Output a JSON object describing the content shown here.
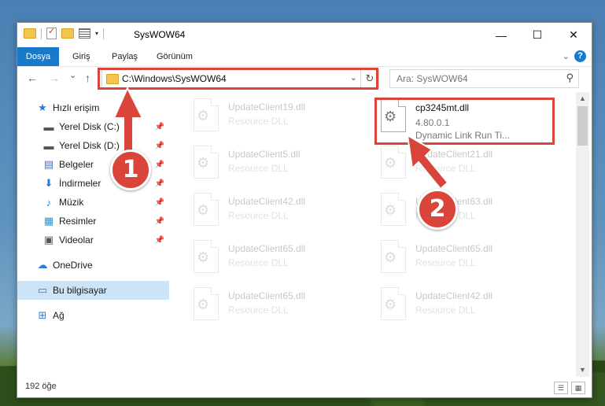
{
  "window": {
    "title": "SysWOW64",
    "controls": {
      "minimize": "—",
      "maximize": "☐",
      "close": "✕"
    }
  },
  "menu": {
    "file": "Dosya",
    "home": "Giriş",
    "share": "Paylaş",
    "view": "Görünüm",
    "help": "?"
  },
  "navigation": {
    "back": "←",
    "forward": "→",
    "recent": "⌄",
    "up": "↑",
    "address": "C:\\Windows\\SysWOW64",
    "refresh": "↻",
    "search_placeholder": "Ara: SysWOW64"
  },
  "sidebar": {
    "items": [
      {
        "label": "Hızlı erişim",
        "icon": "star-icon",
        "pinned": false
      },
      {
        "label": "Yerel Disk (C:)",
        "icon": "drive-icon",
        "pinned": true
      },
      {
        "label": "Yerel Disk (D:)",
        "icon": "drive-icon",
        "pinned": true
      },
      {
        "label": "Belgeler",
        "icon": "documents-icon",
        "pinned": true
      },
      {
        "label": "İndirmeler",
        "icon": "download-icon",
        "pinned": true
      },
      {
        "label": "Müzik",
        "icon": "music-icon",
        "pinned": true
      },
      {
        "label": "Resimler",
        "icon": "pictures-icon",
        "pinned": true
      },
      {
        "label": "Videolar",
        "icon": "videos-icon",
        "pinned": true
      },
      {
        "label": "OneDrive",
        "icon": "cloud-icon",
        "pinned": false
      },
      {
        "label": "Bu bilgisayar",
        "icon": "computer-icon",
        "pinned": false,
        "selected": true
      },
      {
        "label": "Ağ",
        "icon": "network-icon",
        "pinned": false
      }
    ]
  },
  "files": [
    {
      "name": "UpdateClient19.dll",
      "type": "Resource DLL"
    },
    {
      "name": "cp3245mt.dll",
      "version": "4.80.0.1",
      "description": "Dynamic Link Run Ti...",
      "selected": true
    },
    {
      "name": "UpdateClient5.dll",
      "type": "Resource DLL"
    },
    {
      "name": "UpdateClient21.dll",
      "type": "Resource DLL"
    },
    {
      "name": "UpdateClient42.dll",
      "type": "Resource DLL"
    },
    {
      "name": "UpdateClient63.dll",
      "type": "Resource DLL"
    },
    {
      "name": "UpdateClient65.dll",
      "type": "Resource DLL"
    },
    {
      "name": "UpdateClient65.dll",
      "type": "Resource DLL"
    },
    {
      "name": "UpdateClient65.dll",
      "type": "Resource DLL"
    },
    {
      "name": "UpdateClient42.dll",
      "type": "Resource DLL"
    }
  ],
  "status": {
    "item_count": "192 öğe"
  },
  "annotations": {
    "step1": "1",
    "step2": "2",
    "highlight_color": "#d9453b"
  },
  "colors": {
    "accent": "#1979ca",
    "selection": "#cce4f7"
  }
}
